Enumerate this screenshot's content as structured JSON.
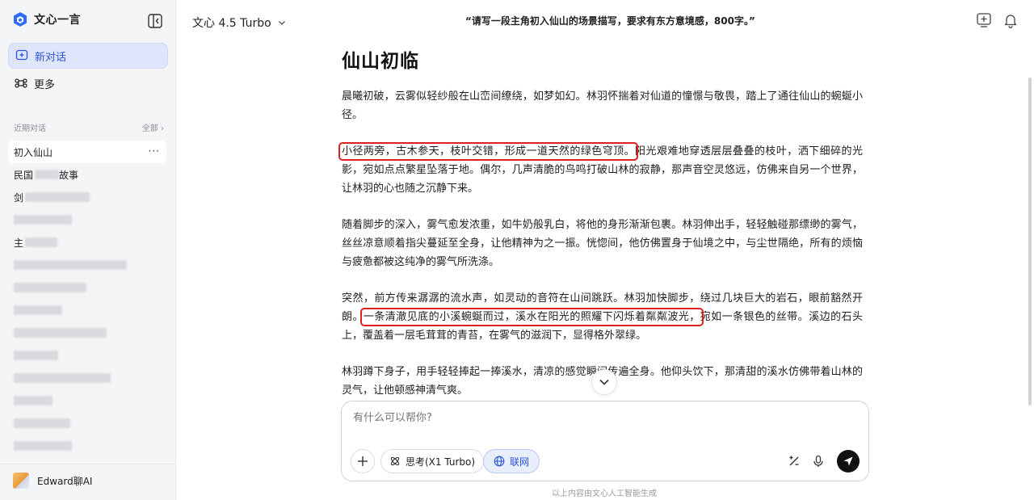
{
  "sidebar": {
    "brand": "文心一言",
    "new_chat": "新对话",
    "more": "更多",
    "recent_label": "近期对话",
    "all_label": "全部 ›",
    "items": [
      {
        "label": "初入仙山",
        "active": true
      },
      {
        "label": "民国"
      },
      {
        "label": "剑"
      },
      {
        "label": ""
      },
      {
        "label": "主"
      }
    ],
    "more_dots": "···",
    "user_name": "Edward聊AI"
  },
  "header": {
    "model": "文心 4.5 Turbo",
    "prompt": "“请写一段主角初入仙山的场景描写，要求有东方意境感，800字。”"
  },
  "article": {
    "title": "仙山初临",
    "p1": "晨曦初破，云雾似轻纱般在山峦间缭绕，如梦如幻。林羽怀揣着对仙道的憧憬与敬畏，踏上了通往仙山的蜿蜒小径。",
    "p2_highlight": "小径两旁，古木参天，枝叶交错，形成一道天然的绿色穹顶。",
    "p2_rest": "阳光艰难地穿透层层叠叠的枝叶，洒下细碎的光影，宛如点点繁星坠落于地。偶尔，几声清脆的鸟鸣打破山林的寂静，那声音空灵悠远，仿佛来自另一个世界，让林羽的心也随之沉静下来。",
    "p3": "随着脚步的深入，雾气愈发浓重，如牛奶般乳白，将他的身形渐渐包裹。林羽伸出手，轻轻触碰那缥缈的雾气，丝丝凉意顺着指尖蔓延至全身，让他精神为之一振。恍惚间，他仿佛置身于仙境之中，与尘世隔绝，所有的烦恼与疲惫都被这纯净的雾气所洗涤。",
    "p4_start": "突然，前方传来潺潺的流水声，如灵动的音符在山间跳跃。林羽加快脚步，绕过几块巨大的岩石，眼前豁然开朗。",
    "p4_highlight": "一条清澈见底的小溪蜿蜒而过，溪水在阳光的照耀下闪烁着粼粼波光，",
    "p4_rest": "宛如一条银色的丝带。溪边的石头上，覆盖着一层毛茸茸的青苔，在雾气的滋润下，显得格外翠绿。",
    "p5": "林羽蹲下身子，用手轻轻捧起一捧溪水，清凉的感觉瞬间传遍全身。他仰头饮下，那清甜的溪水仿佛带着山林的灵气，让他顿感神清气爽。"
  },
  "composer": {
    "placeholder": "有什么可以帮你?",
    "think_label": "思考(X1 Turbo)",
    "web_label": "联网",
    "footer": "以上内容由文心人工智能生成"
  },
  "colors": {
    "accent": "#2b55d6",
    "highlight_border": "#e0201f",
    "sidebar_bg": "#f4f5f7"
  }
}
